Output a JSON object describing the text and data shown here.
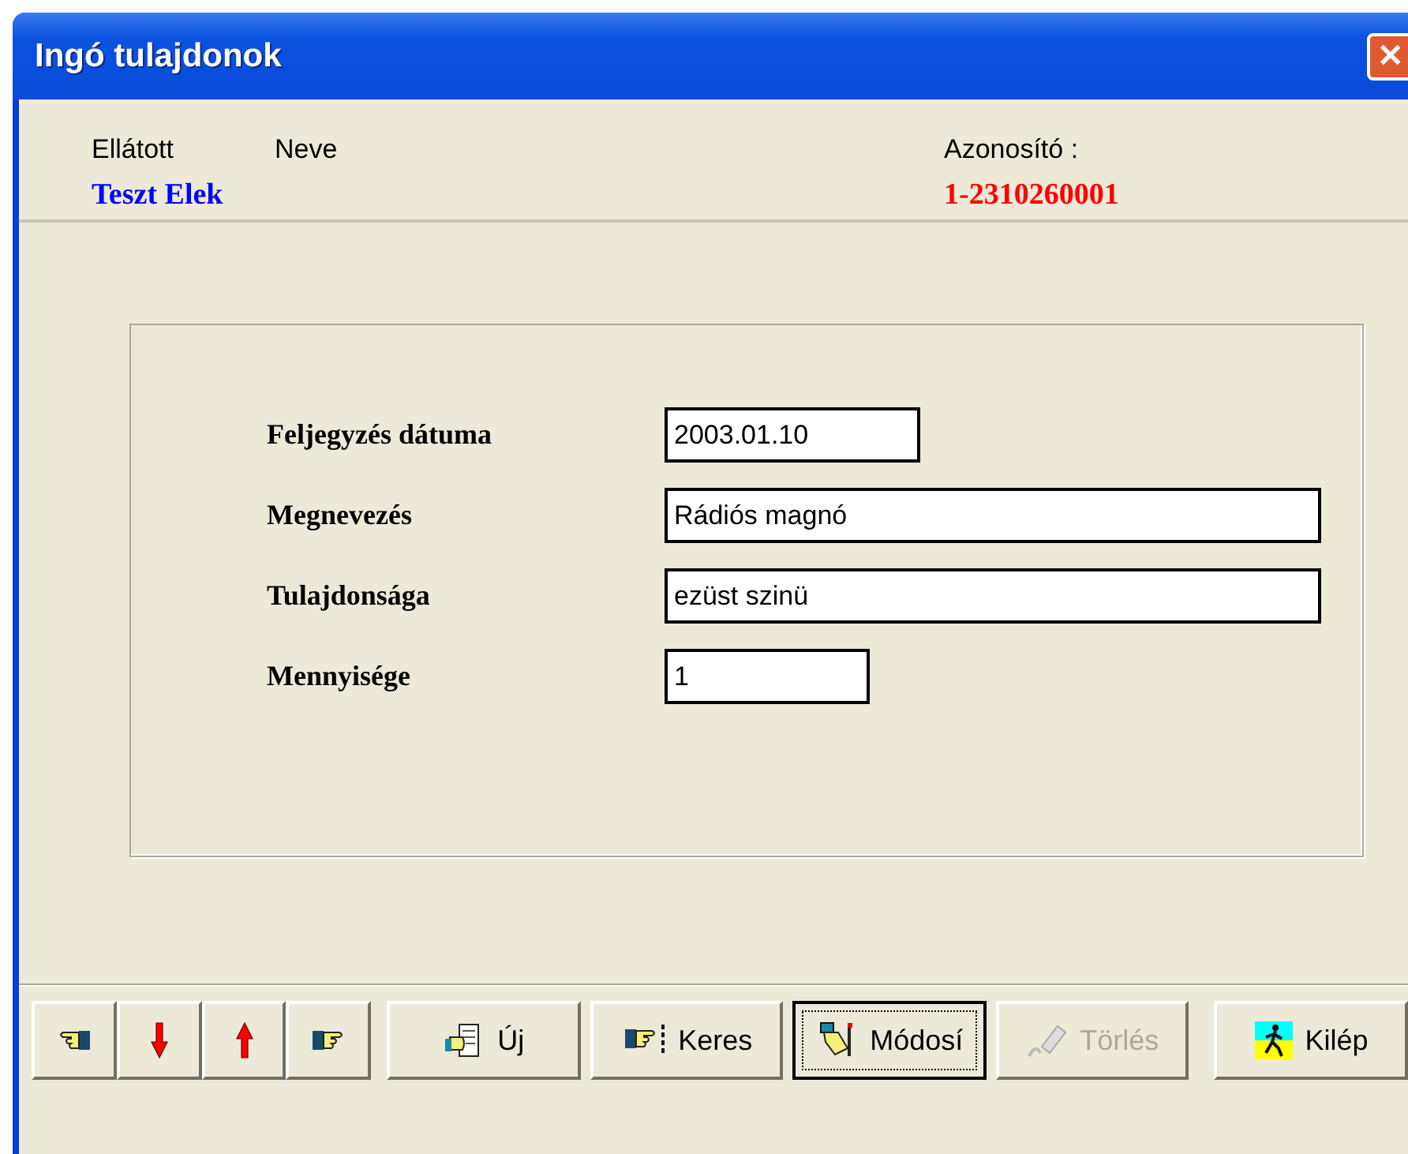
{
  "window": {
    "title": "Ingó tulajdonok",
    "close_symbol": "✕"
  },
  "header": {
    "person_label": "Ellátott",
    "name_label": "Neve",
    "name": "Teszt Elek",
    "id_label": "Azonosító :",
    "id": "1-2310260001"
  },
  "form": {
    "fields": [
      {
        "label": "Feljegyzés dátuma",
        "value": "2003.01.10"
      },
      {
        "label": "Megnevezés",
        "value": "Rádiós magnó"
      },
      {
        "label": "Tulajdonsága",
        "value": "ezüst szinü"
      },
      {
        "label": "Mennyisége",
        "value": "1"
      }
    ]
  },
  "toolbar": [
    {
      "kind": "nav"
    },
    {
      "kind": "nav"
    },
    {
      "kind": "nav"
    },
    {
      "kind": "nav"
    },
    {
      "kind": "action",
      "label": "Új",
      "focused": false,
      "disabled": false
    },
    {
      "kind": "action",
      "label": "Keres",
      "focused": false,
      "disabled": false
    },
    {
      "kind": "action",
      "label": "Módosí",
      "focused": true,
      "disabled": false
    },
    {
      "kind": "action",
      "label": "Törlés",
      "focused": false,
      "disabled": true
    },
    {
      "kind": "action",
      "label": "Kilép",
      "focused": false,
      "disabled": false
    }
  ]
}
